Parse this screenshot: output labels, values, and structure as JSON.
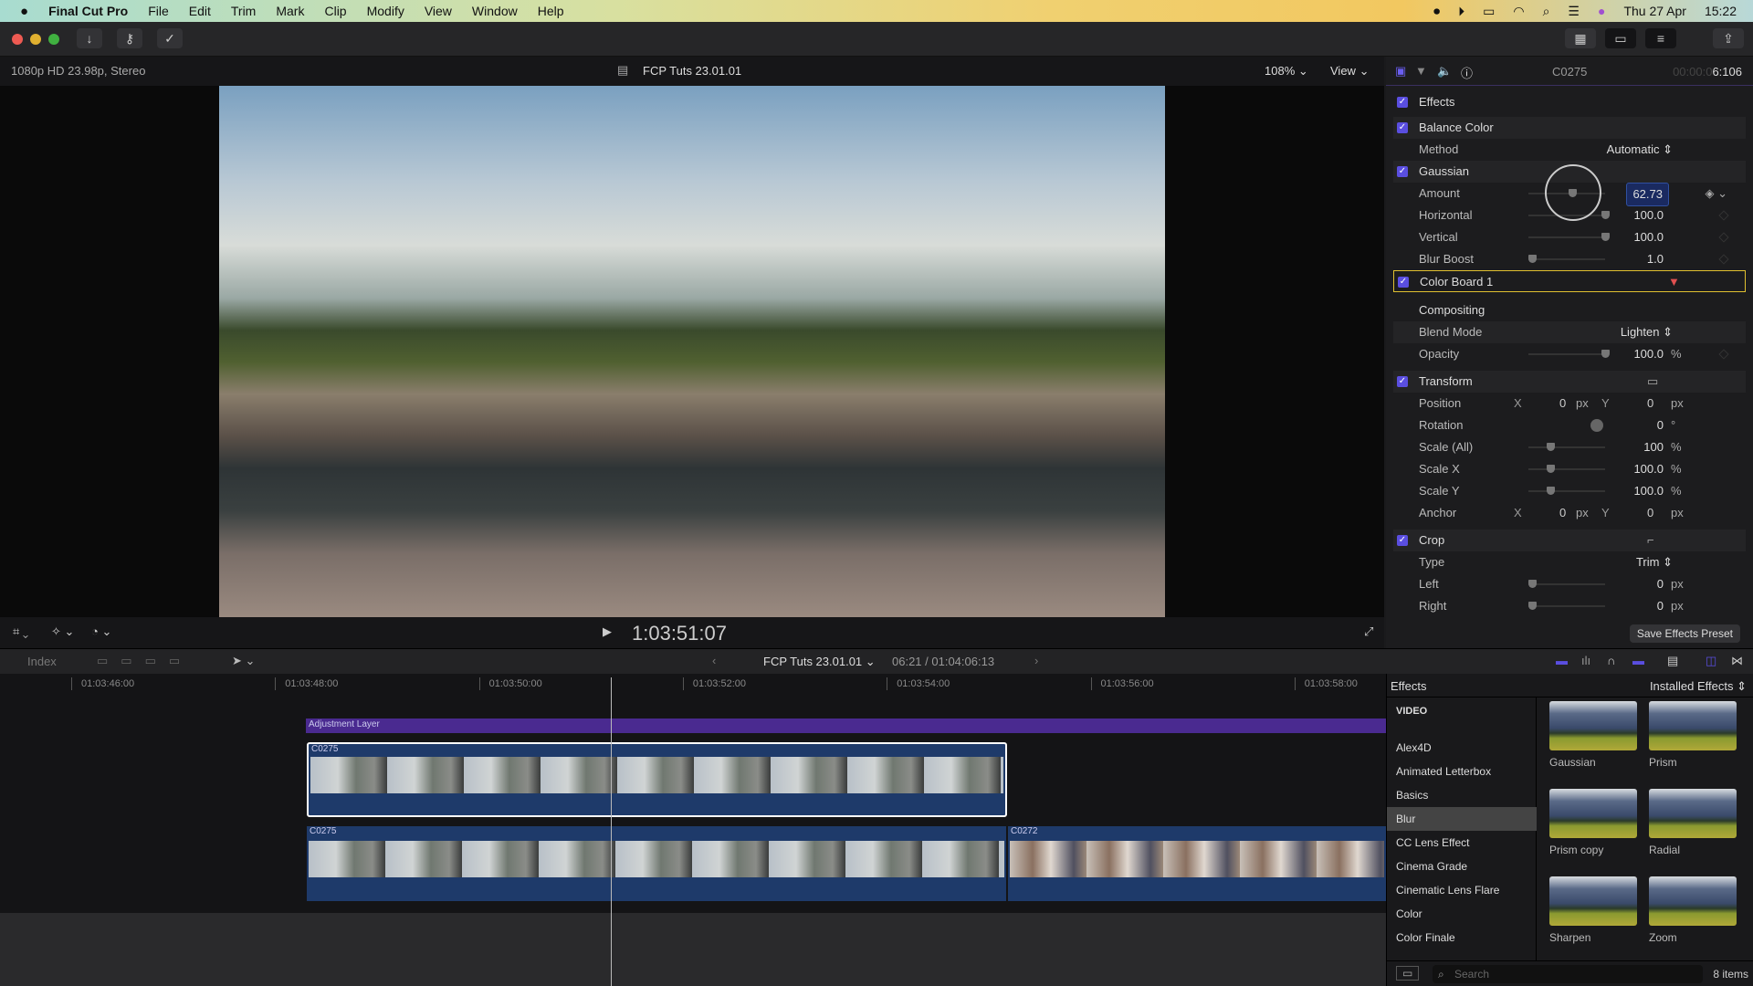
{
  "menubar": {
    "apple": "",
    "app": "Final Cut Pro",
    "items": [
      "File",
      "Edit",
      "Trim",
      "Mark",
      "Clip",
      "Modify",
      "View",
      "Window",
      "Help"
    ],
    "date": "Thu 27 Apr",
    "time": "15:22"
  },
  "viewer": {
    "format": "1080p HD 23.98p, Stereo",
    "project": "FCP Tuts 23.01.01",
    "zoom": "108%",
    "view": "View",
    "timecode": "1:03:51:07"
  },
  "inspector": {
    "clip": "C0275",
    "duration_dim": "00:00:0",
    "duration": "6:106",
    "effects": "Effects",
    "balance": "Balance Color",
    "method_label": "Method",
    "method": "Automatic",
    "gaussian": "Gaussian",
    "params": [
      {
        "label": "Amount",
        "value": "62.73",
        "pct": 0.55
      },
      {
        "label": "Horizontal",
        "value": "100.0",
        "pct": 1
      },
      {
        "label": "Vertical",
        "value": "100.0",
        "pct": 1
      },
      {
        "label": "Blur Boost",
        "value": "1.0",
        "pct": 0
      }
    ],
    "colorboard": "Color Board 1",
    "compositing": "Compositing",
    "blend_label": "Blend Mode",
    "blend": "Lighten",
    "opacity_label": "Opacity",
    "opacity": "100.0",
    "pct_unit": "%",
    "transform": "Transform",
    "position": "Position",
    "rotation": "Rotation",
    "rotation_val": "0",
    "deg": "°",
    "scale_all": "Scale (All)",
    "scale_all_val": "100",
    "scale_x": "Scale X",
    "scale_x_val": "100.0",
    "scale_y": "Scale Y",
    "scale_y_val": "100.0",
    "anchor": "Anchor",
    "x": "X",
    "y": "Y",
    "zero": "0",
    "px": "px",
    "crop": "Crop",
    "type_label": "Type",
    "type": "Trim",
    "left": "Left",
    "right": "Right",
    "save_preset": "Save Effects Preset"
  },
  "timeline": {
    "index": "Index",
    "project": "FCP Tuts 23.01.01",
    "position": "06:21 / 01:04:06:13",
    "ruler": [
      "01:03:46:00",
      "01:03:48:00",
      "01:03:50:00",
      "01:03:52:00",
      "01:03:54:00",
      "01:03:56:00",
      "01:03:58:00"
    ],
    "adjustment": "Adjustment Layer",
    "clip_connected": "C0275",
    "clip_primary1": "C0275",
    "clip_primary2": "C0272"
  },
  "browser": {
    "title": "Effects",
    "source": "Installed Effects",
    "section": "VIDEO",
    "partial_top": "...",
    "categories": [
      "Alex4D",
      "Animated Letterbox",
      "Basics",
      "Blur",
      "CC Lens Effect",
      "Cinema Grade",
      "Cinematic Lens Flare",
      "Color",
      "Color Finale"
    ],
    "selected": "Blur",
    "effects": [
      "Gaussian",
      "Prism",
      "Prism copy",
      "Radial",
      "Sharpen",
      "Zoom"
    ],
    "search_placeholder": "Search",
    "count": "8 items"
  },
  "colors": {
    "accent": "#5a4ee0",
    "adjustment": "#4a2a90",
    "primary": "#1e3a6a",
    "highlight": "#e0c030"
  }
}
